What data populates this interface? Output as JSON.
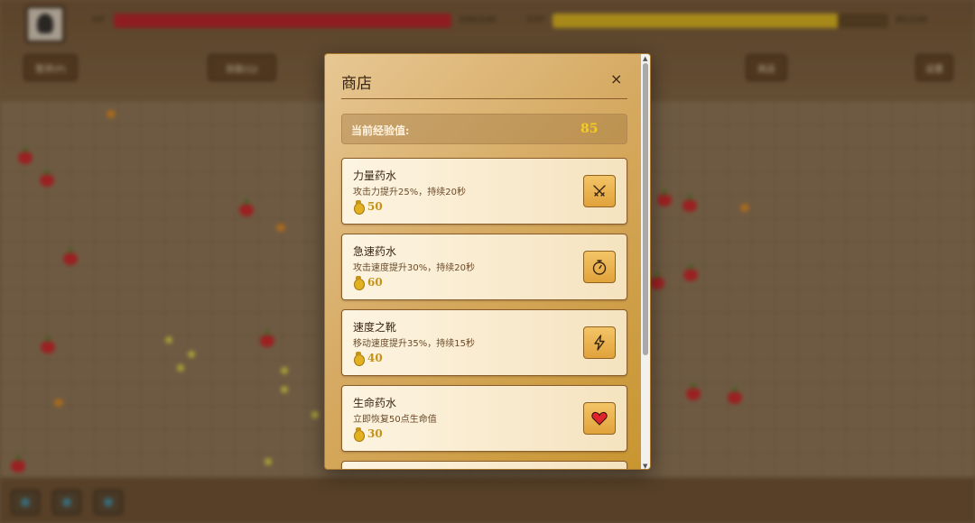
{
  "hud": {
    "hp_label": "HP",
    "hp_text": "100/100",
    "hp_ratio": 1.0,
    "xp_label": "EXP",
    "xp_text": "85/100",
    "xp_ratio": 0.85,
    "buttons": [
      "暂停(P)",
      "技能(Q)",
      "商店",
      "设置"
    ]
  },
  "shop": {
    "title": "商店",
    "close_label": "×",
    "current_exp_label": "当前经验值:",
    "current_exp_value": "85",
    "items": [
      {
        "name": "力量药水",
        "description": "攻击力提升25%，持续20秒",
        "price": "50",
        "icon": "crossed-swords-icon"
      },
      {
        "name": "急速药水",
        "description": "攻击速度提升30%，持续20秒",
        "price": "60",
        "icon": "stopwatch-icon"
      },
      {
        "name": "速度之靴",
        "description": "移动速度提升35%，持续15秒",
        "price": "40",
        "icon": "lightning-icon"
      },
      {
        "name": "生命药水",
        "description": "立即恢复50点生命值",
        "price": "30",
        "icon": "heart-icon"
      }
    ]
  },
  "colors": {
    "hp_bar": "#b61f2a",
    "xp_bar": "#d9b520",
    "modal_bg": "#d6aa63",
    "exp_value": "#f1cc22",
    "price": "#c4921a"
  }
}
